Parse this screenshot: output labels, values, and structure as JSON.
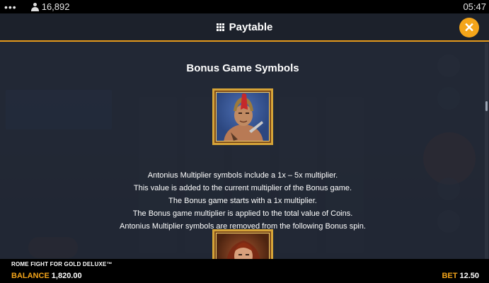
{
  "status_bar": {
    "dots": "•••",
    "player_count": "16,892",
    "time": "05:47"
  },
  "header": {
    "title": "Paytable",
    "close_label": "✕"
  },
  "section": {
    "title": "Bonus Game Symbols"
  },
  "description_lines": [
    "Antonius Multiplier symbols include a 1x – 5x multiplier.",
    "This value is added to the current multiplier of the Bonus game.",
    "The Bonus game starts with a 1x multiplier.",
    "The Bonus game multiplier is applied to the total value of Coins.",
    "Antonius Multiplier symbols are removed from the following Bonus spin."
  ],
  "footer": {
    "game_name": "ROME FIGHT FOR GOLD DELUXE™",
    "balance_label": "BALANCE",
    "balance_value": "1,820.00",
    "bet_label": "BET",
    "bet_value": "12.50"
  },
  "colors": {
    "accent": "#f4a51a",
    "frame_gold": "#d6a437",
    "header_bg": "#1c212b"
  },
  "icons": {
    "menu": "menu-dots-icon",
    "players": "person-icon",
    "paytable": "grid-icon",
    "close": "close-icon"
  }
}
